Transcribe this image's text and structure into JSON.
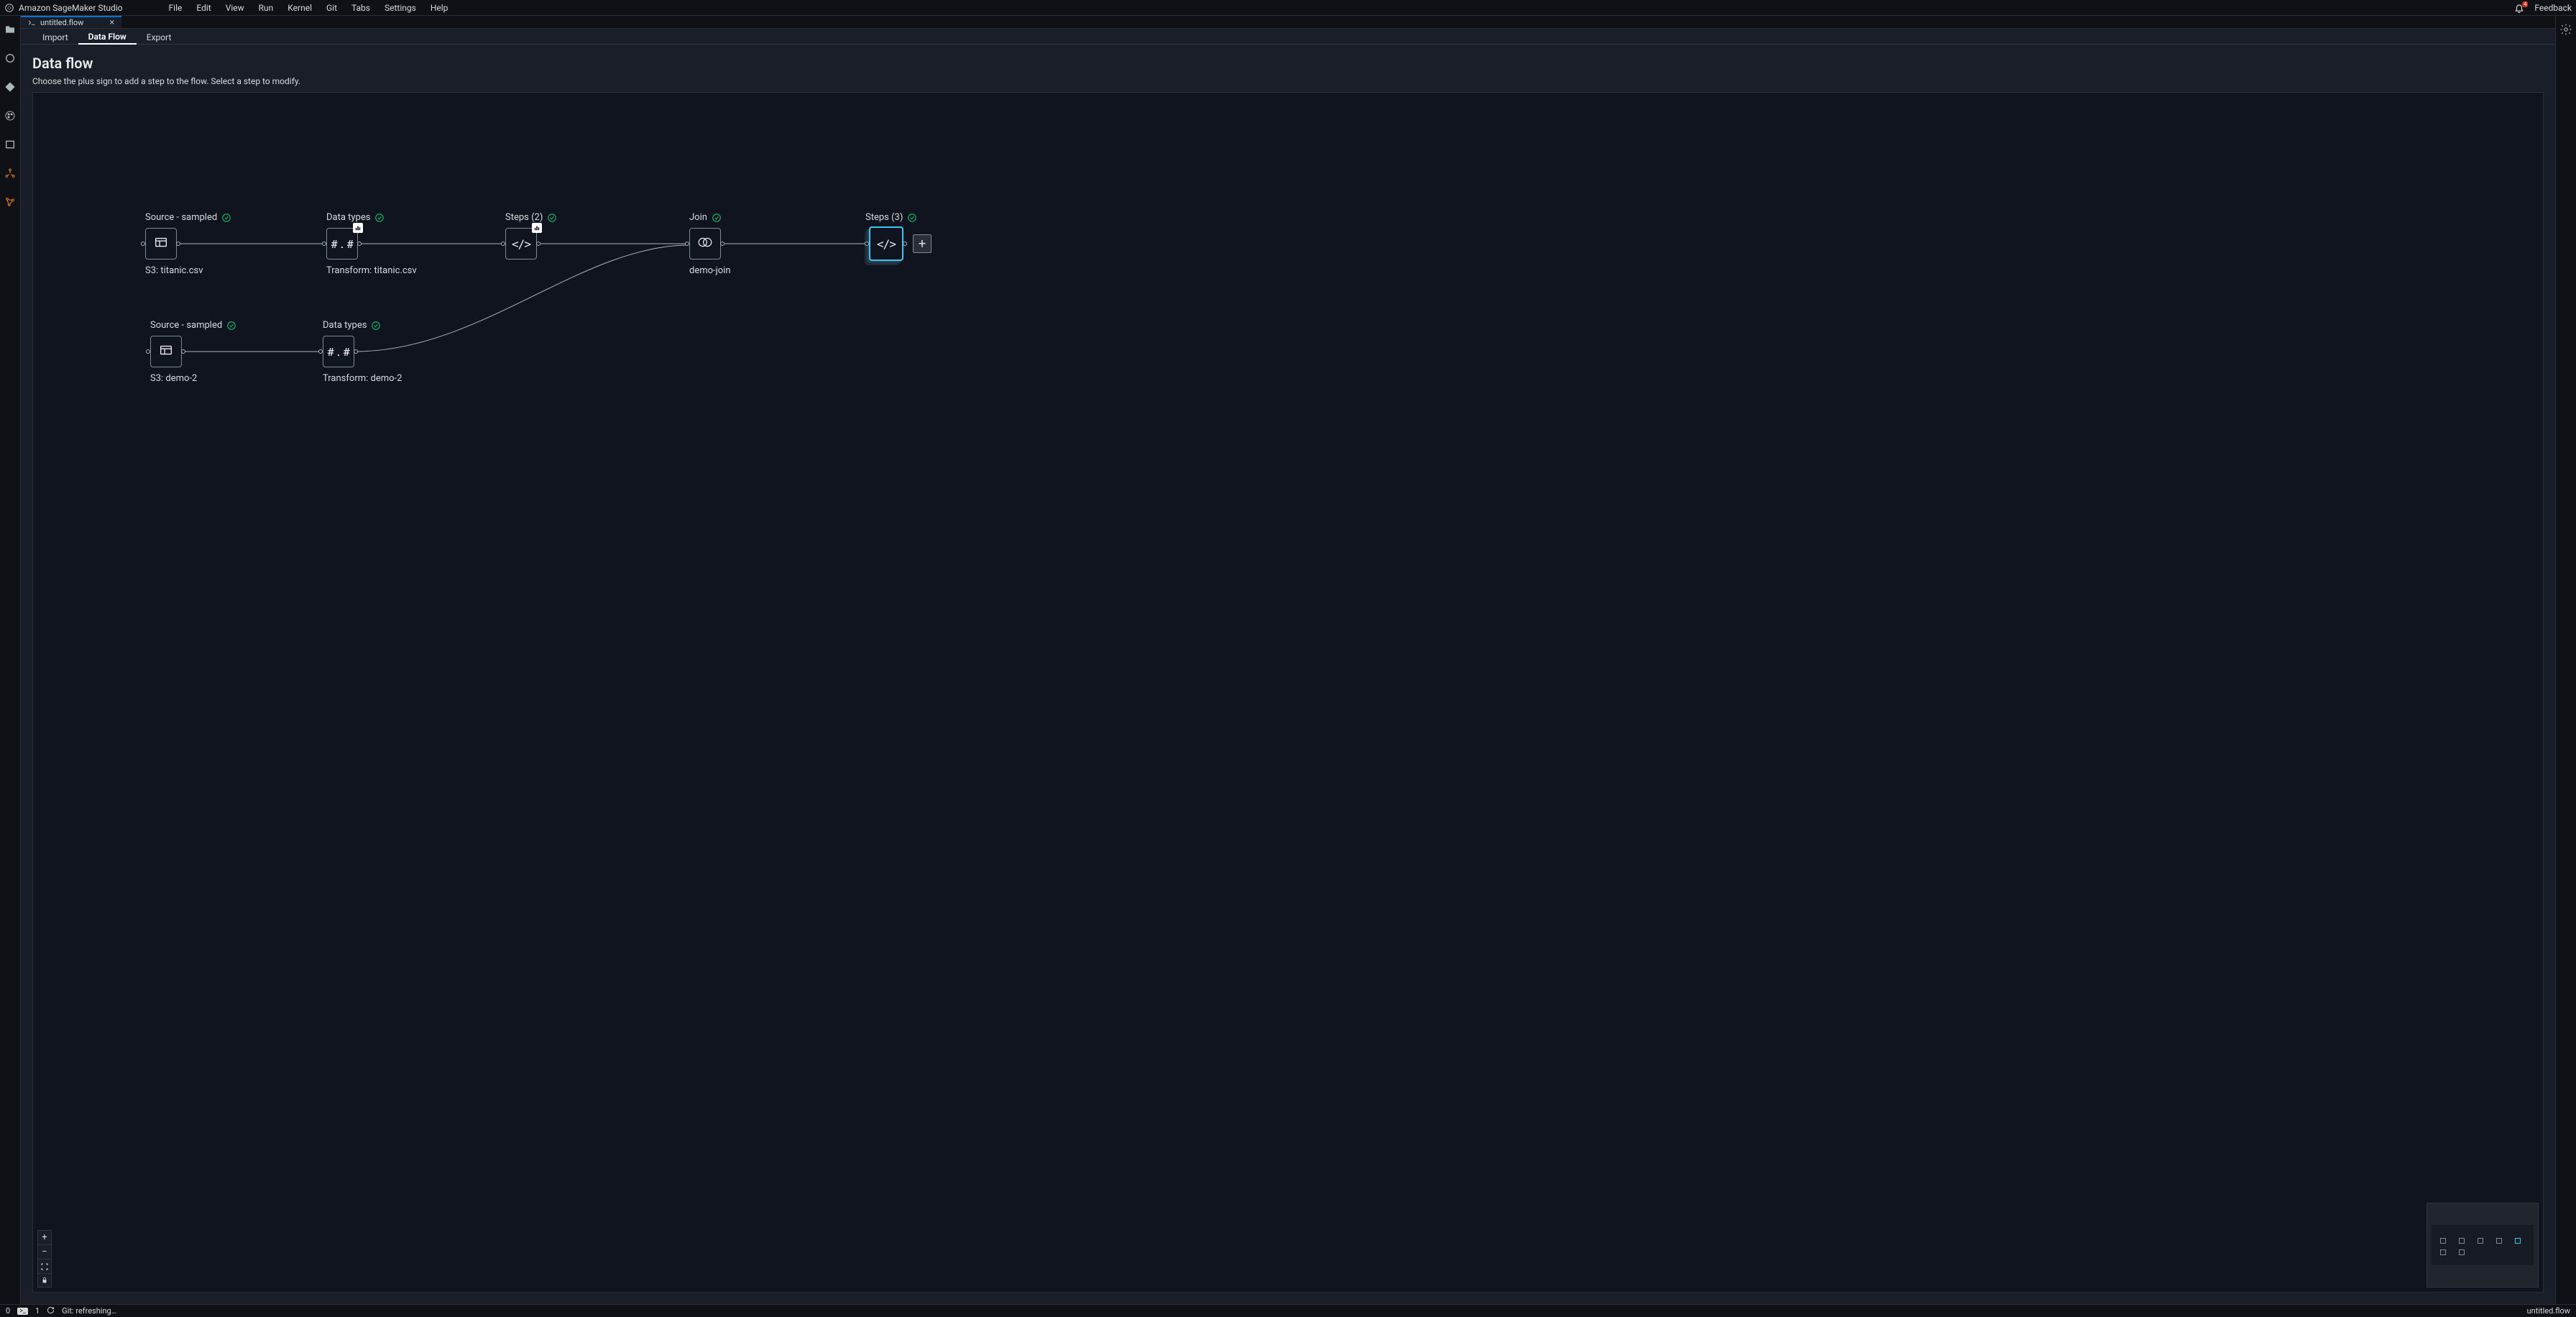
{
  "topbar": {
    "app_title": "Amazon SageMaker Studio",
    "menus": [
      "File",
      "Edit",
      "View",
      "Run",
      "Kernel",
      "Git",
      "Tabs",
      "Settings",
      "Help"
    ],
    "notification_count": "4",
    "feedback": "Feedback"
  },
  "tab": {
    "filename": "untitled.flow"
  },
  "subtabs": {
    "import": "Import",
    "dataflow": "Data Flow",
    "export": "Export"
  },
  "header": {
    "title": "Data flow",
    "subtitle": "Choose the plus sign to add a step to the flow. Select a step to modify."
  },
  "nodes": {
    "source1": {
      "title": "Source - sampled",
      "sub": "S3: titanic.csv"
    },
    "dtypes1": {
      "title": "Data types",
      "sub": "Transform: titanic.csv",
      "inner": "# . #"
    },
    "steps2": {
      "title": "Steps (2)",
      "inner": "</>"
    },
    "join": {
      "title": "Join",
      "sub": "demo-join"
    },
    "steps3": {
      "title": "Steps (3)",
      "inner": "</>"
    },
    "source2": {
      "title": "Source - sampled",
      "sub": "S3: demo-2"
    },
    "dtypes2": {
      "title": "Data types",
      "sub": "Transform: demo-2",
      "inner": "# . #"
    }
  },
  "statusbar": {
    "zero": "0",
    "one": "1",
    "git": "Git: refreshing…",
    "right": "untitled.flow"
  }
}
